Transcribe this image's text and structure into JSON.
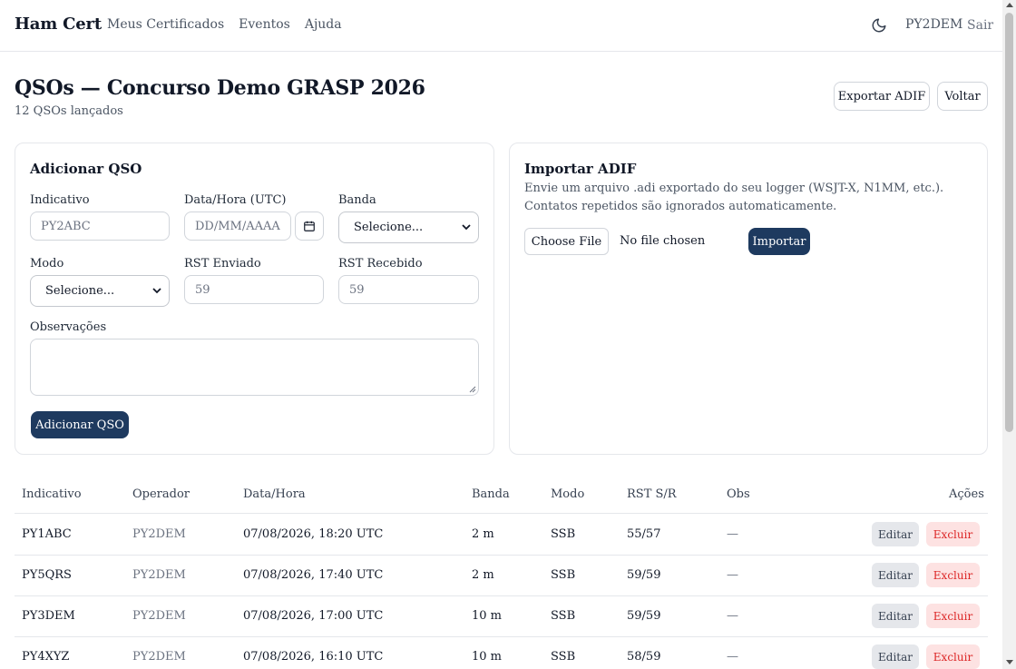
{
  "header": {
    "brand": "Ham Cert",
    "nav": [
      "Meus Certificados",
      "Eventos",
      "Ajuda"
    ],
    "theme_icon": "moon-icon",
    "user": "PY2DEM",
    "logout": "Sair"
  },
  "page": {
    "title": "QSOs — Concurso Demo GRASP 2026",
    "subtitle": "12 QSOs lançados",
    "export_button": "Exportar ADIF",
    "back_button": "Voltar"
  },
  "add_form": {
    "title": "Adicionar QSO",
    "callsign_label": "Indicativo",
    "callsign_placeholder": "PY2ABC",
    "datetime_label": "Data/Hora (UTC)",
    "datetime_placeholder": "DD/MM/AAAA",
    "band_label": "Banda",
    "band_selected": "Selecione...",
    "mode_label": "Modo",
    "mode_selected": "Selecione...",
    "rst_sent_label": "RST Enviado",
    "rst_sent_placeholder": "59",
    "rst_received_label": "RST Recebido",
    "rst_received_placeholder": "59",
    "notes_label": "Observações",
    "submit_button": "Adicionar QSO"
  },
  "import": {
    "title": "Importar ADIF",
    "description": "Envie um arquivo .adi exportado do seu logger (WSJT-X, N1MM, etc.). Contatos repetidos são ignorados automaticamente.",
    "choose_file": "Choose File",
    "no_file": "No file chosen",
    "import_button": "Importar"
  },
  "table": {
    "columns": [
      "Indicativo",
      "Operador",
      "Data/Hora",
      "Banda",
      "Modo",
      "RST S/R",
      "Obs",
      "Ações"
    ],
    "edit_label": "Editar",
    "delete_label": "Excluir",
    "rows": [
      {
        "callsign": "PY1ABC",
        "operator": "PY2DEM",
        "datetime": "07/08/2026, 18:20 UTC",
        "band": "2 m",
        "mode": "SSB",
        "rst": "55/57",
        "obs": "—"
      },
      {
        "callsign": "PY5QRS",
        "operator": "PY2DEM",
        "datetime": "07/08/2026, 17:40 UTC",
        "band": "2 m",
        "mode": "SSB",
        "rst": "59/59",
        "obs": "—"
      },
      {
        "callsign": "PY3DEM",
        "operator": "PY2DEM",
        "datetime": "07/08/2026, 17:00 UTC",
        "band": "10 m",
        "mode": "SSB",
        "rst": "59/59",
        "obs": "—"
      },
      {
        "callsign": "PY4XYZ",
        "operator": "PY2DEM",
        "datetime": "07/08/2026, 16:10 UTC",
        "band": "10 m",
        "mode": "SSB",
        "rst": "58/59",
        "obs": "—"
      }
    ]
  },
  "colors": {
    "primary": "#1e3a5f",
    "danger": "#dc2626",
    "danger_bg": "#fde2e2",
    "border": "#e5e7eb"
  }
}
